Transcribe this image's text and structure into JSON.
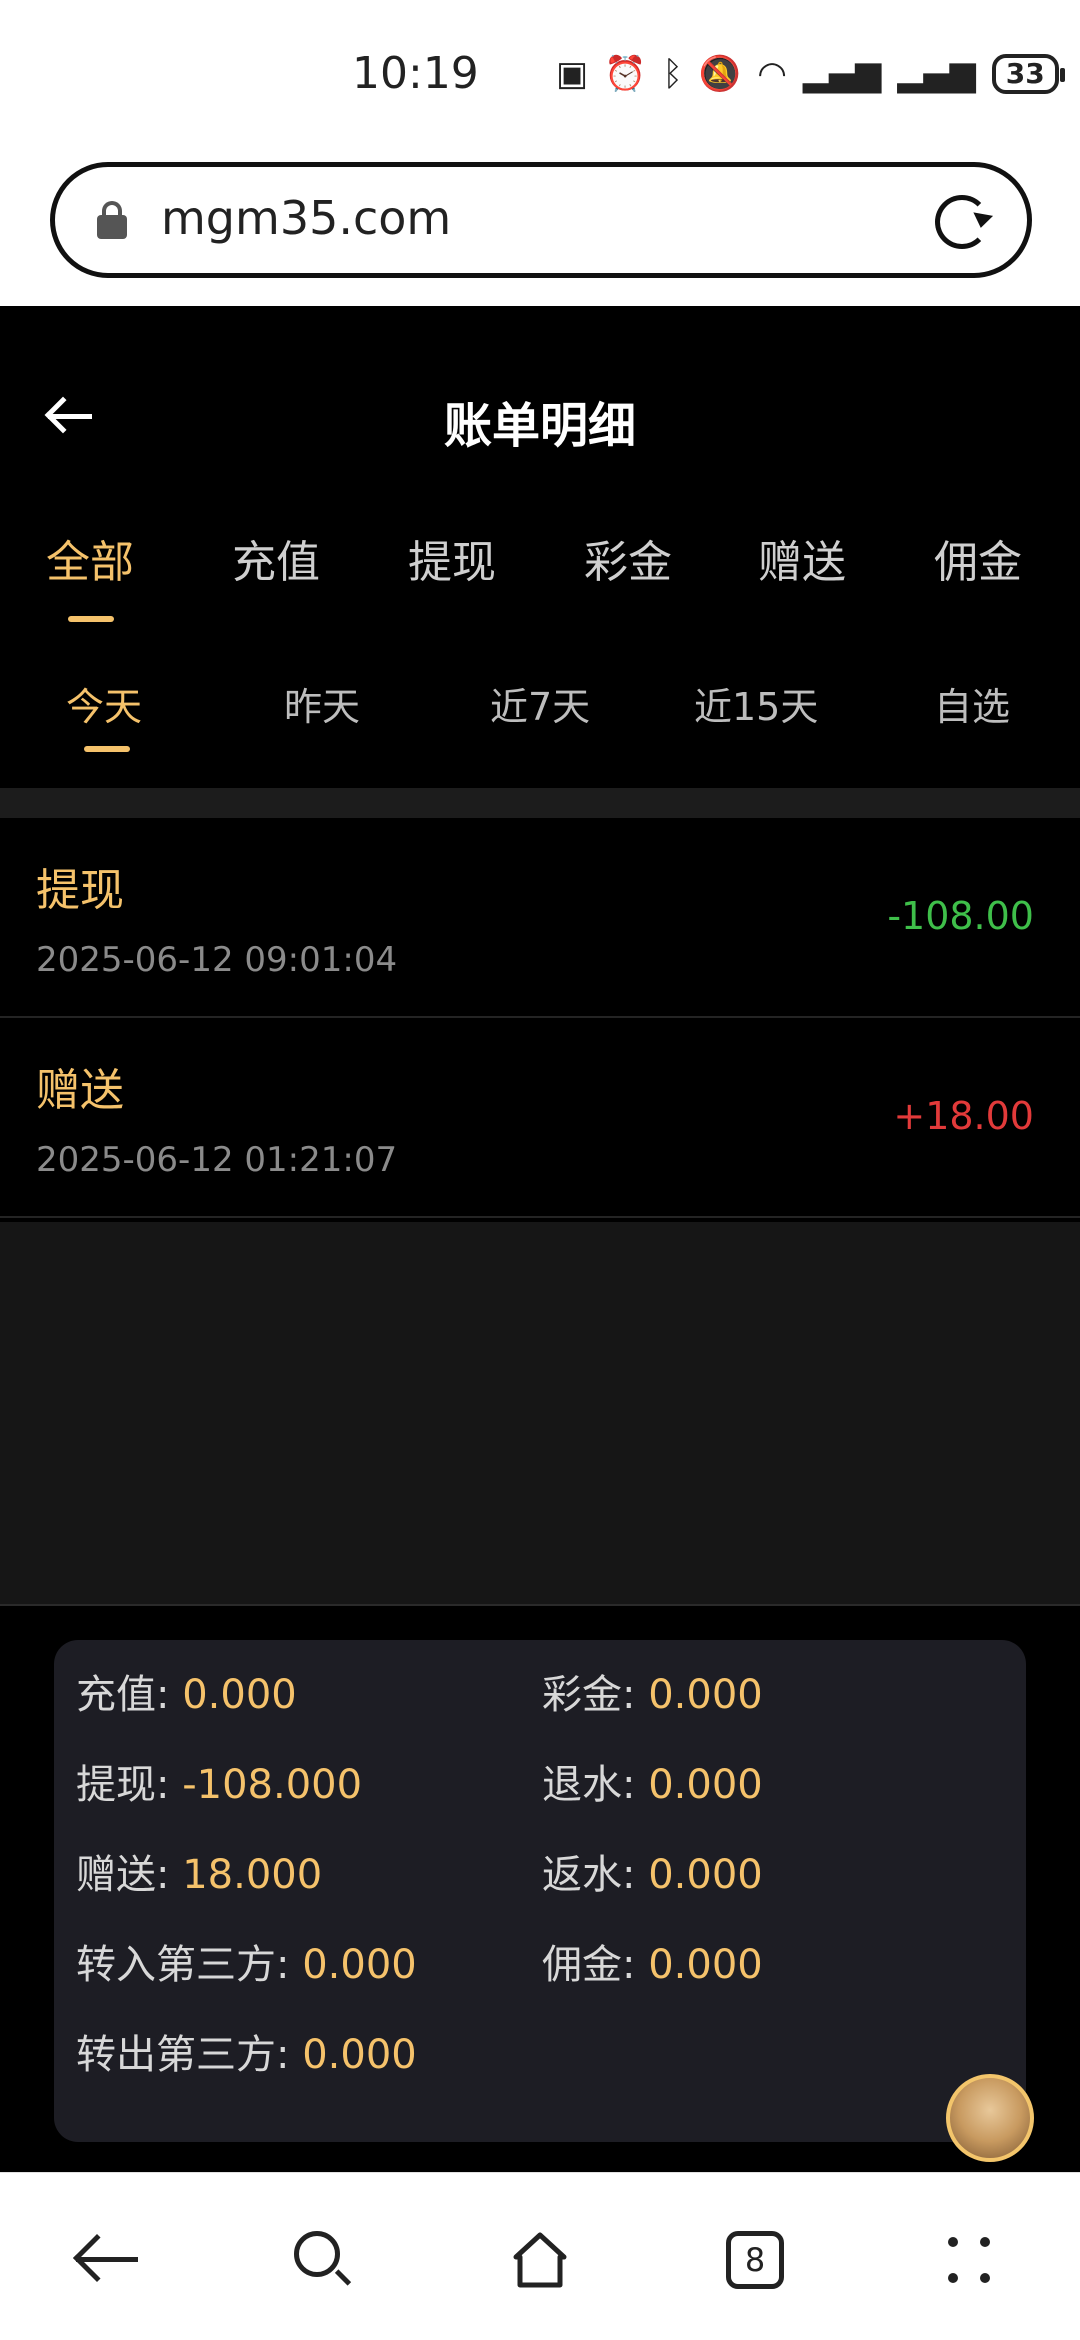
{
  "status_bar": {
    "time": "10:19",
    "icons": [
      "nfc-icon",
      "alarm-icon",
      "bluetooth-icon",
      "mute-icon",
      "wifi-icon",
      "signal-icon",
      "signal-5g-icon"
    ],
    "battery": "33"
  },
  "browser": {
    "url": "mgm35.com"
  },
  "header": {
    "title": "账单明细"
  },
  "tabs": [
    {
      "label": "全部",
      "active": true
    },
    {
      "label": "充值",
      "active": false
    },
    {
      "label": "提现",
      "active": false
    },
    {
      "label": "彩金",
      "active": false
    },
    {
      "label": "赠送",
      "active": false
    },
    {
      "label": "佣金",
      "active": false
    }
  ],
  "ranges": [
    {
      "label": "今天",
      "active": true
    },
    {
      "label": "昨天",
      "active": false
    },
    {
      "label": "近7天",
      "active": false
    },
    {
      "label": "近15天",
      "active": false
    },
    {
      "label": "自选",
      "active": false
    }
  ],
  "records": [
    {
      "type": "提现",
      "datetime": "2025-06-12 09:01:04",
      "amount": "-108.00",
      "color": "#3fbf4a"
    },
    {
      "type": "赠送",
      "datetime": "2025-06-12 01:21:07",
      "amount": "+18.00",
      "color": "#e23a3a"
    }
  ],
  "summary": {
    "recharge_label": "充值:",
    "recharge_value": "0.000",
    "bonus_label": "彩金:",
    "bonus_value": "0.000",
    "withdraw_label": "提现:",
    "withdraw_value": "-108.000",
    "refund_label": "退水:",
    "refund_value": "0.000",
    "gift_label": "赠送:",
    "gift_value": "18.000",
    "rebate_label": "返水:",
    "rebate_value": "0.000",
    "transfer_in_label": "转入第三方:",
    "transfer_in_value": "0.000",
    "commission_label": "佣金:",
    "commission_value": "0.000",
    "transfer_out_label": "转出第三方:",
    "transfer_out_value": "0.000"
  },
  "bottom_nav": {
    "tab_count": "8"
  },
  "colors": {
    "accent": "#f5c26b",
    "negative": "#3fbf4a",
    "positive": "#e23a3a"
  }
}
